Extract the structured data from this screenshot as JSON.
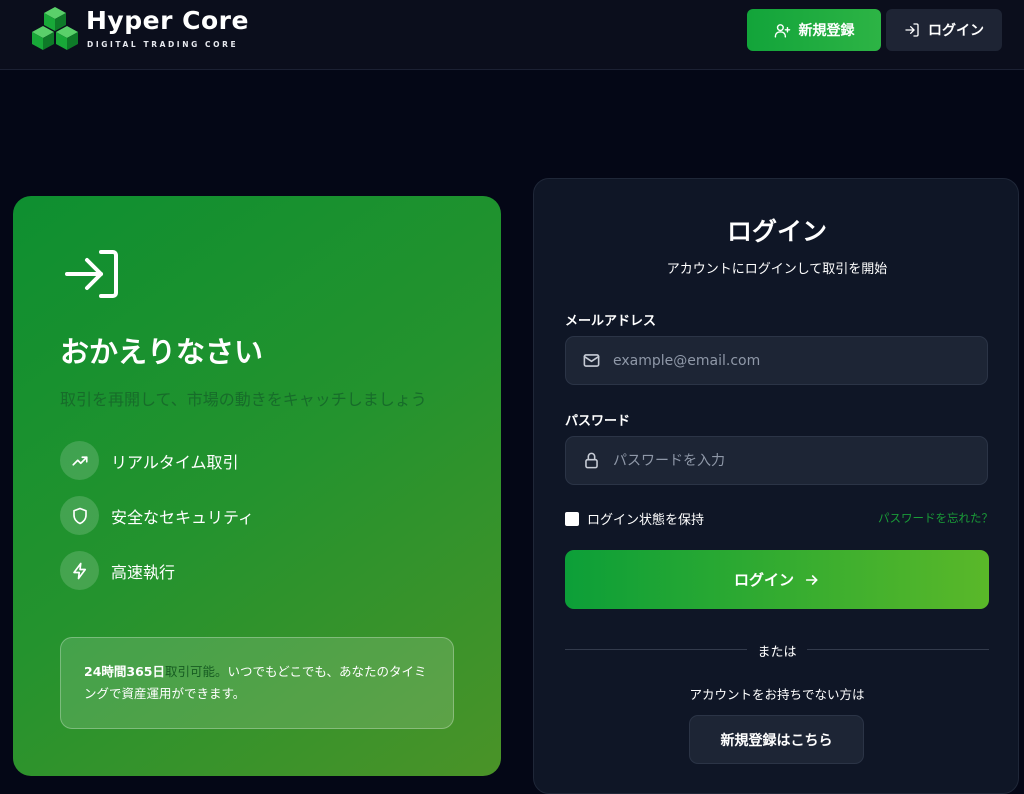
{
  "header": {
    "brand_name": "Hyper Core",
    "brand_tagline": "DIGITAL TRADING CORE",
    "register_label": "新規登録",
    "login_label": "ログイン"
  },
  "welcome": {
    "title": "おかえりなさい",
    "subtitle": "取引を再開して、市場の動きをキャッチしましょう",
    "features": [
      {
        "label": "リアルタイム取引",
        "icon": "trending-up-icon"
      },
      {
        "label": "安全なセキュリティ",
        "icon": "shield-icon"
      },
      {
        "label": "高速執行",
        "icon": "lightning-icon"
      }
    ],
    "info_strong": "24時間365日",
    "info_highlight": "取引可能。",
    "info_rest": "いつでもどこでも、あなたのタイミングで資産運用ができます。"
  },
  "login": {
    "title": "ログイン",
    "subtitle": "アカウントにログインして取引を開始",
    "email_label": "メールアドレス",
    "email_placeholder": "example@email.com",
    "password_label": "パスワード",
    "password_placeholder": "パスワードを入力",
    "remember_label": "ログイン状態を保持",
    "forgot_label": "パスワードを忘れた？",
    "submit_label": "ログイン",
    "divider_label": "または",
    "no_account_label": "アカウントをお持ちでない方は",
    "signup_label": "新規登録はこちら"
  },
  "colors": {
    "primary_green": "#12a43a",
    "background": "#040716",
    "card": "#0f1626"
  }
}
